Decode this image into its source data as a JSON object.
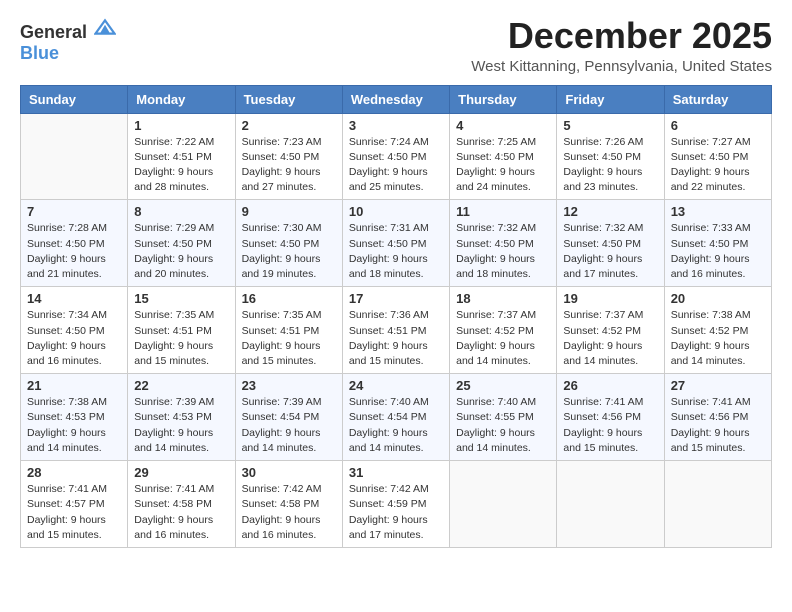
{
  "header": {
    "logo_general": "General",
    "logo_blue": "Blue",
    "month_title": "December 2025",
    "location": "West Kittanning, Pennsylvania, United States"
  },
  "weekdays": [
    "Sunday",
    "Monday",
    "Tuesday",
    "Wednesday",
    "Thursday",
    "Friday",
    "Saturday"
  ],
  "weeks": [
    [
      {
        "day": "",
        "sunrise": "",
        "sunset": "",
        "daylight": ""
      },
      {
        "day": "1",
        "sunrise": "Sunrise: 7:22 AM",
        "sunset": "Sunset: 4:51 PM",
        "daylight": "Daylight: 9 hours and 28 minutes."
      },
      {
        "day": "2",
        "sunrise": "Sunrise: 7:23 AM",
        "sunset": "Sunset: 4:50 PM",
        "daylight": "Daylight: 9 hours and 27 minutes."
      },
      {
        "day": "3",
        "sunrise": "Sunrise: 7:24 AM",
        "sunset": "Sunset: 4:50 PM",
        "daylight": "Daylight: 9 hours and 25 minutes."
      },
      {
        "day": "4",
        "sunrise": "Sunrise: 7:25 AM",
        "sunset": "Sunset: 4:50 PM",
        "daylight": "Daylight: 9 hours and 24 minutes."
      },
      {
        "day": "5",
        "sunrise": "Sunrise: 7:26 AM",
        "sunset": "Sunset: 4:50 PM",
        "daylight": "Daylight: 9 hours and 23 minutes."
      },
      {
        "day": "6",
        "sunrise": "Sunrise: 7:27 AM",
        "sunset": "Sunset: 4:50 PM",
        "daylight": "Daylight: 9 hours and 22 minutes."
      }
    ],
    [
      {
        "day": "7",
        "sunrise": "Sunrise: 7:28 AM",
        "sunset": "Sunset: 4:50 PM",
        "daylight": "Daylight: 9 hours and 21 minutes."
      },
      {
        "day": "8",
        "sunrise": "Sunrise: 7:29 AM",
        "sunset": "Sunset: 4:50 PM",
        "daylight": "Daylight: 9 hours and 20 minutes."
      },
      {
        "day": "9",
        "sunrise": "Sunrise: 7:30 AM",
        "sunset": "Sunset: 4:50 PM",
        "daylight": "Daylight: 9 hours and 19 minutes."
      },
      {
        "day": "10",
        "sunrise": "Sunrise: 7:31 AM",
        "sunset": "Sunset: 4:50 PM",
        "daylight": "Daylight: 9 hours and 18 minutes."
      },
      {
        "day": "11",
        "sunrise": "Sunrise: 7:32 AM",
        "sunset": "Sunset: 4:50 PM",
        "daylight": "Daylight: 9 hours and 18 minutes."
      },
      {
        "day": "12",
        "sunrise": "Sunrise: 7:32 AM",
        "sunset": "Sunset: 4:50 PM",
        "daylight": "Daylight: 9 hours and 17 minutes."
      },
      {
        "day": "13",
        "sunrise": "Sunrise: 7:33 AM",
        "sunset": "Sunset: 4:50 PM",
        "daylight": "Daylight: 9 hours and 16 minutes."
      }
    ],
    [
      {
        "day": "14",
        "sunrise": "Sunrise: 7:34 AM",
        "sunset": "Sunset: 4:50 PM",
        "daylight": "Daylight: 9 hours and 16 minutes."
      },
      {
        "day": "15",
        "sunrise": "Sunrise: 7:35 AM",
        "sunset": "Sunset: 4:51 PM",
        "daylight": "Daylight: 9 hours and 15 minutes."
      },
      {
        "day": "16",
        "sunrise": "Sunrise: 7:35 AM",
        "sunset": "Sunset: 4:51 PM",
        "daylight": "Daylight: 9 hours and 15 minutes."
      },
      {
        "day": "17",
        "sunrise": "Sunrise: 7:36 AM",
        "sunset": "Sunset: 4:51 PM",
        "daylight": "Daylight: 9 hours and 15 minutes."
      },
      {
        "day": "18",
        "sunrise": "Sunrise: 7:37 AM",
        "sunset": "Sunset: 4:52 PM",
        "daylight": "Daylight: 9 hours and 14 minutes."
      },
      {
        "day": "19",
        "sunrise": "Sunrise: 7:37 AM",
        "sunset": "Sunset: 4:52 PM",
        "daylight": "Daylight: 9 hours and 14 minutes."
      },
      {
        "day": "20",
        "sunrise": "Sunrise: 7:38 AM",
        "sunset": "Sunset: 4:52 PM",
        "daylight": "Daylight: 9 hours and 14 minutes."
      }
    ],
    [
      {
        "day": "21",
        "sunrise": "Sunrise: 7:38 AM",
        "sunset": "Sunset: 4:53 PM",
        "daylight": "Daylight: 9 hours and 14 minutes."
      },
      {
        "day": "22",
        "sunrise": "Sunrise: 7:39 AM",
        "sunset": "Sunset: 4:53 PM",
        "daylight": "Daylight: 9 hours and 14 minutes."
      },
      {
        "day": "23",
        "sunrise": "Sunrise: 7:39 AM",
        "sunset": "Sunset: 4:54 PM",
        "daylight": "Daylight: 9 hours and 14 minutes."
      },
      {
        "day": "24",
        "sunrise": "Sunrise: 7:40 AM",
        "sunset": "Sunset: 4:54 PM",
        "daylight": "Daylight: 9 hours and 14 minutes."
      },
      {
        "day": "25",
        "sunrise": "Sunrise: 7:40 AM",
        "sunset": "Sunset: 4:55 PM",
        "daylight": "Daylight: 9 hours and 14 minutes."
      },
      {
        "day": "26",
        "sunrise": "Sunrise: 7:41 AM",
        "sunset": "Sunset: 4:56 PM",
        "daylight": "Daylight: 9 hours and 15 minutes."
      },
      {
        "day": "27",
        "sunrise": "Sunrise: 7:41 AM",
        "sunset": "Sunset: 4:56 PM",
        "daylight": "Daylight: 9 hours and 15 minutes."
      }
    ],
    [
      {
        "day": "28",
        "sunrise": "Sunrise: 7:41 AM",
        "sunset": "Sunset: 4:57 PM",
        "daylight": "Daylight: 9 hours and 15 minutes."
      },
      {
        "day": "29",
        "sunrise": "Sunrise: 7:41 AM",
        "sunset": "Sunset: 4:58 PM",
        "daylight": "Daylight: 9 hours and 16 minutes."
      },
      {
        "day": "30",
        "sunrise": "Sunrise: 7:42 AM",
        "sunset": "Sunset: 4:58 PM",
        "daylight": "Daylight: 9 hours and 16 minutes."
      },
      {
        "day": "31",
        "sunrise": "Sunrise: 7:42 AM",
        "sunset": "Sunset: 4:59 PM",
        "daylight": "Daylight: 9 hours and 17 minutes."
      },
      {
        "day": "",
        "sunrise": "",
        "sunset": "",
        "daylight": ""
      },
      {
        "day": "",
        "sunrise": "",
        "sunset": "",
        "daylight": ""
      },
      {
        "day": "",
        "sunrise": "",
        "sunset": "",
        "daylight": ""
      }
    ]
  ]
}
